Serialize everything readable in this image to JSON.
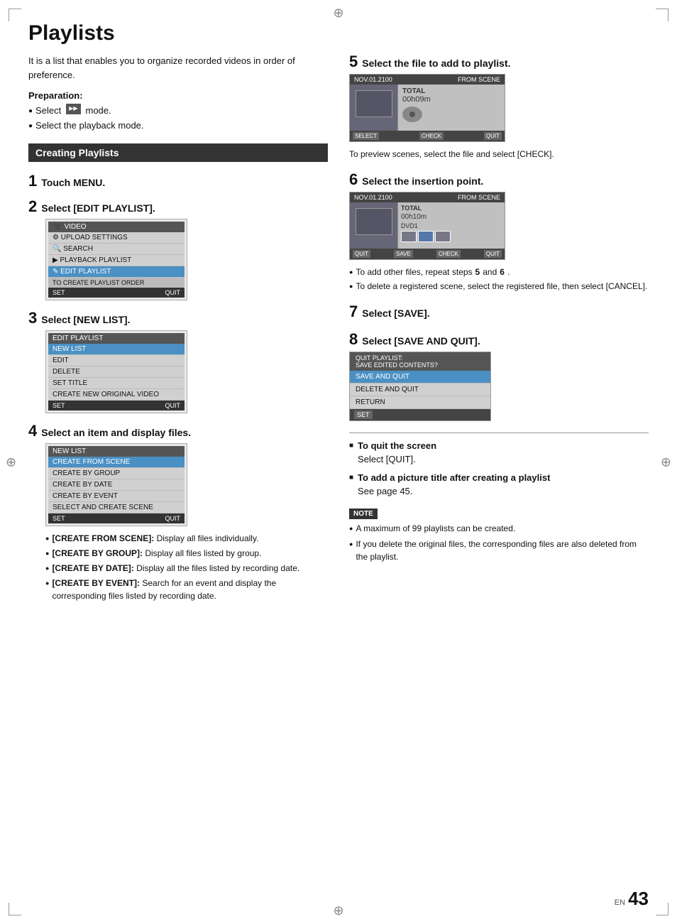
{
  "page": {
    "title": "Playlists",
    "intro": "It is a list that enables you to organize recorded videos in order of preference.",
    "preparation_label": "Preparation:",
    "preparation_bullets": [
      "Select  mode.",
      "Select the playback mode."
    ],
    "section_header": "Creating Playlists",
    "steps_left": [
      {
        "num": "1",
        "text": "Touch MENU."
      },
      {
        "num": "2",
        "text": "Select [EDIT PLAYLIST]."
      },
      {
        "num": "3",
        "text": "Select [NEW LIST]."
      },
      {
        "num": "4",
        "text": "Select an item and display files."
      }
    ],
    "steps_right": [
      {
        "num": "5",
        "text": "Select the file to add to playlist."
      },
      {
        "num": "6",
        "text": "Select the insertion point."
      },
      {
        "num": "7",
        "text": "Select [SAVE]."
      },
      {
        "num": "8",
        "text": "Select [SAVE AND QUIT]."
      }
    ],
    "menu2": {
      "title": "VIDEO",
      "items": [
        "UPLOAD SETTINGS",
        "SEARCH",
        "PLAYBACK PLAYLIST",
        "EDIT PLAYLIST"
      ],
      "footer": "TO CREATE PLAYLIST ORDER",
      "footer_left": "SET",
      "footer_right": "QUIT"
    },
    "menu3": {
      "title": "EDIT PLAYLIST",
      "items": [
        "NEW LIST",
        "EDIT",
        "DELETE",
        "SET TITLE",
        "CREATE NEW ORIGINAL VIDEO"
      ],
      "footer_left": "SET",
      "footer_right": "QUIT"
    },
    "menu4": {
      "title": "NEW LIST",
      "items": [
        "CREATE FROM SCENE",
        "CREATE BY GROUP",
        "CREATE BY DATE",
        "CREATE BY EVENT",
        "SELECT AND CREATE SCENE"
      ],
      "footer_left": "SET",
      "footer_right": "QUIT"
    },
    "sub_bullets_4": [
      {
        "label": "[CREATE FROM SCENE]:",
        "text": "Display all files individually."
      },
      {
        "label": "[CREATE BY GROUP]:",
        "text": "Display all files listed by group."
      },
      {
        "label": "[CREATE BY DATE]:",
        "text": "Display all the files listed by recording date."
      },
      {
        "label": "[CREATE BY EVENT]:",
        "text": "Search for an event and display the corresponding files listed by recording date."
      }
    ],
    "cam5": {
      "header_left": "NOV.01.2100",
      "header_right": "FROM SCENE",
      "info_label": "TOTAL",
      "info_value": "00h09m"
    },
    "cam5_footer": {
      "left": "SELECT",
      "mid": "CHECK",
      "right": "QUIT"
    },
    "step5_note": "To preview scenes, select the file and select [CHECK].",
    "cam6": {
      "header_left": "NOV.01.2100",
      "header_right": "FROM SCENE",
      "info_label": "TOTAL",
      "info_value": "00h10m",
      "label2": "DVD1"
    },
    "cam6_footer": {
      "btn1": "QUIT",
      "btn2": "SAVE",
      "btn3": "CHECK",
      "btn4": "QUIT"
    },
    "step6_bullets": [
      "To add other files, repeat steps 5 and 6.",
      "To delete a registered scene, select the registered file, then select [CANCEL]."
    ],
    "save_menu": {
      "header": "QUIT PLAYLIST:\nSAVE EDITED CONTENTS?",
      "items": [
        "SAVE AND QUIT",
        "DELETE AND QUIT",
        "RETURN"
      ],
      "footer_btn": "SET"
    },
    "sq_bullets": [
      {
        "label": "To quit the screen",
        "text": "Select [QUIT]."
      },
      {
        "label": "To add a picture title after creating a playlist",
        "text": "See page 45."
      }
    ],
    "note_label": "NOTE",
    "note_bullets": [
      "A maximum of 99 playlists can be created.",
      "If you delete the original files, the corresponding files are also deleted from the playlist."
    ],
    "page_num_en": "EN",
    "page_num": "43"
  }
}
